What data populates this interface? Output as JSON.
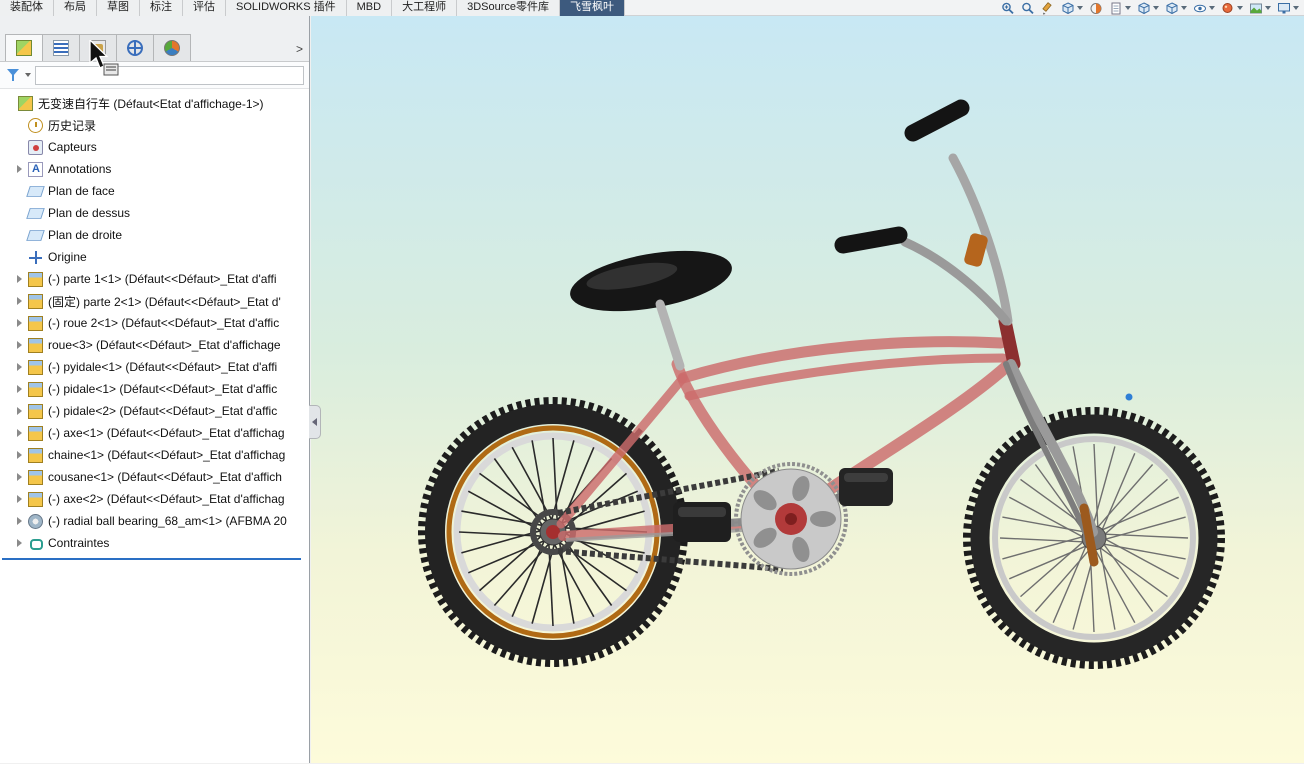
{
  "ribbon": {
    "tabs": [
      {
        "label": "装配体",
        "active": false
      },
      {
        "label": "布局",
        "active": false
      },
      {
        "label": "草图",
        "active": false
      },
      {
        "label": "标注",
        "active": false
      },
      {
        "label": "评估",
        "active": false
      },
      {
        "label": "SOLIDWORKS 插件",
        "active": false
      },
      {
        "label": "MBD",
        "active": false
      },
      {
        "label": "大工程师",
        "active": false
      },
      {
        "label": "3DSource零件库",
        "active": false
      },
      {
        "label": "飞雪枫叶",
        "active": true
      }
    ]
  },
  "quick_toolbar": {
    "icons": [
      {
        "name": "zoom-to-fit-icon",
        "glyph": "magnifierPlus",
        "dropdown": false
      },
      {
        "name": "zoom-to-area-icon",
        "glyph": "magnifier",
        "dropdown": false
      },
      {
        "name": "edit-component-icon",
        "glyph": "pencil",
        "dropdown": false
      },
      {
        "name": "assembly-visualization-icon",
        "glyph": "cube",
        "dropdown": true
      },
      {
        "name": "section-view-icon",
        "glyph": "section",
        "dropdown": false
      },
      {
        "name": "drawing-sheet-icon",
        "glyph": "doc",
        "dropdown": true
      },
      {
        "name": "view-orientation-icon",
        "glyph": "cube",
        "dropdown": true
      },
      {
        "name": "display-style-icon",
        "glyph": "cube",
        "dropdown": true
      },
      {
        "name": "hide-show-items-icon",
        "glyph": "eye",
        "dropdown": true
      },
      {
        "name": "edit-appearance-icon",
        "glyph": "paint",
        "dropdown": true
      },
      {
        "name": "apply-scene-icon",
        "glyph": "scene",
        "dropdown": true
      },
      {
        "name": "view-settings-icon",
        "glyph": "display",
        "dropdown": true
      }
    ]
  },
  "feature_panel": {
    "tabs": [
      {
        "name": "featuremanager",
        "icon": "assembly",
        "active": true
      },
      {
        "name": "propertymanager",
        "icon": "tree",
        "active": false
      },
      {
        "name": "configurationmanager",
        "icon": "property",
        "active": false
      },
      {
        "name": "dimxpertmanager",
        "icon": "config",
        "active": false
      },
      {
        "name": "displaymanager",
        "icon": "display",
        "active": false
      }
    ],
    "chevron": ">",
    "filter": {
      "value": "",
      "placeholder": ""
    },
    "tree": [
      {
        "label": "无变速自行车  (Défaut<Etat d'affichage-1>)",
        "icon": "assembly",
        "arrow": false,
        "level": 0
      },
      {
        "label": "历史记录",
        "icon": "history",
        "arrow": false,
        "level": 1
      },
      {
        "label": "Capteurs",
        "icon": "sensors",
        "arrow": false,
        "level": 1
      },
      {
        "label": "Annotations",
        "icon": "annotations",
        "arrow": true,
        "level": 1
      },
      {
        "label": "Plan de face",
        "icon": "plane",
        "arrow": false,
        "level": 1
      },
      {
        "label": "Plan de dessus",
        "icon": "plane",
        "arrow": false,
        "level": 1
      },
      {
        "label": "Plan de droite",
        "icon": "plane",
        "arrow": false,
        "level": 1
      },
      {
        "label": "Origine",
        "icon": "origin",
        "arrow": false,
        "level": 1
      },
      {
        "label": "(-) parte 1<1> (Défaut<<Défaut>_Etat d'affi",
        "icon": "part",
        "arrow": true,
        "level": 1
      },
      {
        "label": "(固定) parte 2<1> (Défaut<<Défaut>_Etat d'",
        "icon": "part",
        "arrow": true,
        "level": 1
      },
      {
        "label": "(-) roue 2<1> (Défaut<<Défaut>_Etat d'affic",
        "icon": "part",
        "arrow": true,
        "level": 1
      },
      {
        "label": "roue<3> (Défaut<<Défaut>_Etat d'affichage",
        "icon": "part",
        "arrow": true,
        "level": 1
      },
      {
        "label": "(-) pyidale<1> (Défaut<<Défaut>_Etat d'affi",
        "icon": "part",
        "arrow": true,
        "level": 1
      },
      {
        "label": "(-) pidale<1> (Défaut<<Défaut>_Etat d'affic",
        "icon": "part",
        "arrow": true,
        "level": 1
      },
      {
        "label": "(-) pidale<2> (Défaut<<Défaut>_Etat d'affic",
        "icon": "part",
        "arrow": true,
        "level": 1
      },
      {
        "label": "(-) axe<1> (Défaut<<Défaut>_Etat d'affichag",
        "icon": "part",
        "arrow": true,
        "level": 1
      },
      {
        "label": "chaine<1> (Défaut<<Défaut>_Etat d'affichag",
        "icon": "part",
        "arrow": true,
        "level": 1
      },
      {
        "label": "cousane<1> (Défaut<<Défaut>_Etat d'affich",
        "icon": "part",
        "arrow": true,
        "level": 1
      },
      {
        "label": "(-) axe<2> (Défaut<<Défaut>_Etat d'affichag",
        "icon": "part",
        "arrow": true,
        "level": 1
      },
      {
        "label": "(-) radial ball bearing_68_am<1> (AFBMA 20",
        "icon": "toolbox",
        "arrow": true,
        "level": 1
      },
      {
        "label": "Contraintes",
        "icon": "mates",
        "arrow": true,
        "level": 1
      }
    ]
  },
  "viewport": {
    "model": "无变速自行车 (single-speed bicycle assembly)",
    "bg_top": "#c8e8f4",
    "bg_bottom": "#fdfbda",
    "frame_color": "#cc6b6b",
    "selection_dot_color": "#2f7fd6"
  }
}
